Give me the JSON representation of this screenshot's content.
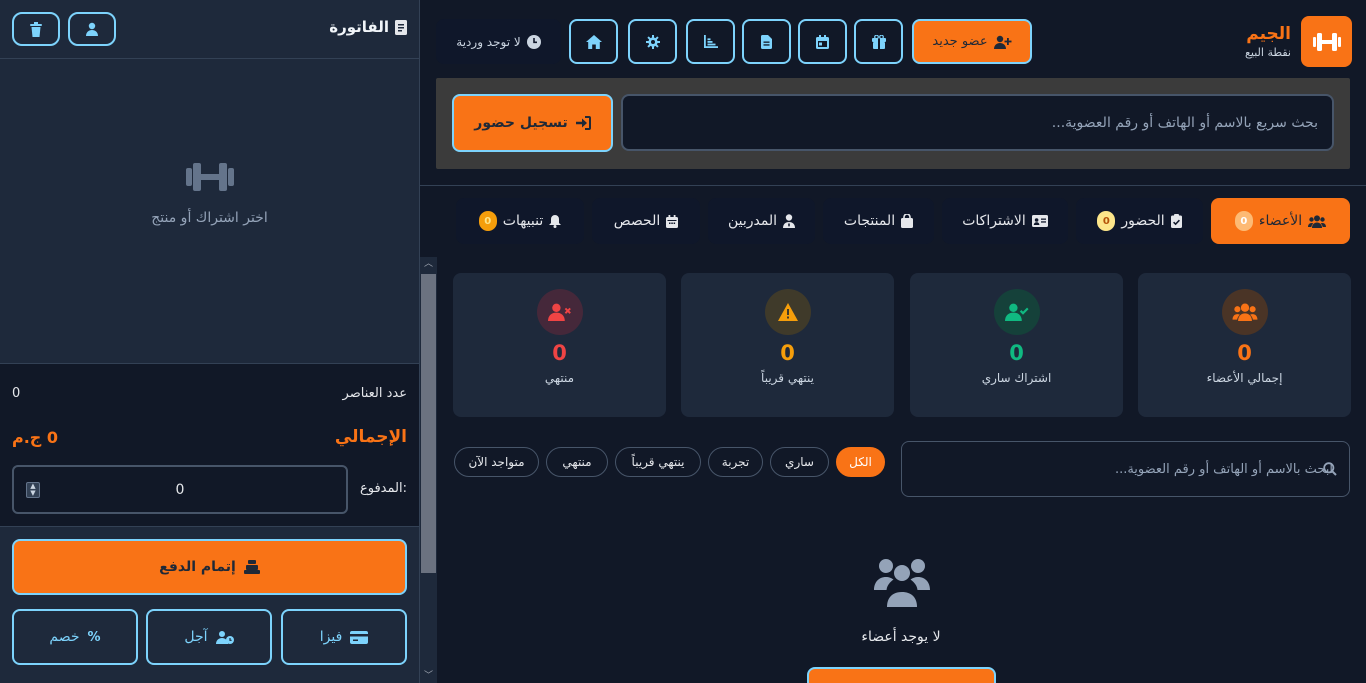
{
  "invoice": {
    "title": "الفاتورة",
    "empty_text": "اختر اشتراك أو منتج",
    "items_label": "عدد العناصر",
    "items_count": "0",
    "total_label": "الإجمالي",
    "total_value": "0 ج.م",
    "paid_label": "المدفوع:",
    "paid_value": "0",
    "complete_payment": "إتمام الدفع",
    "visa": "فيزا",
    "deferred": "آجل",
    "discount": "خصم"
  },
  "brand": {
    "name": "الجيم",
    "subtitle": "نقطة البيع"
  },
  "header": {
    "new_member": "عضو جديد",
    "shift_status": "لا توجد وردية",
    "nav_icons": [
      "gift-icon",
      "calendar-icon",
      "document-icon",
      "chart-icon",
      "gear-icon",
      "home-icon"
    ]
  },
  "quick_search": {
    "placeholder": "بحث سريع بالاسم أو الهاتف أو رقم العضوية...",
    "checkin": "تسجيل حضور"
  },
  "tabs": [
    {
      "label": "الأعضاء",
      "badge": "0"
    },
    {
      "label": "الحضور",
      "badge": "0"
    },
    {
      "label": "الاشتراكات"
    },
    {
      "label": "المنتجات"
    },
    {
      "label": "المدربين"
    },
    {
      "label": "الحصص"
    },
    {
      "label": "تنبيهات",
      "badge": "0"
    }
  ],
  "stats": [
    {
      "label": "إجمالي الأعضاء",
      "value": "0",
      "color": "#f97316"
    },
    {
      "label": "اشتراك ساري",
      "value": "0",
      "color": "#10b981"
    },
    {
      "label": "ينتهي قريباً",
      "value": "0",
      "color": "#f59e0b"
    },
    {
      "label": "منتهي",
      "value": "0",
      "color": "#ef4444"
    }
  ],
  "member_search": {
    "placeholder": "ابحث بالاسم أو الهاتف أو رقم العضوية..."
  },
  "filters": [
    "الكل",
    "ساري",
    "تجربة",
    "ينتهي قريباً",
    "منتهي",
    "متواجد الآن"
  ],
  "empty_members": "لا يوجد أعضاء"
}
